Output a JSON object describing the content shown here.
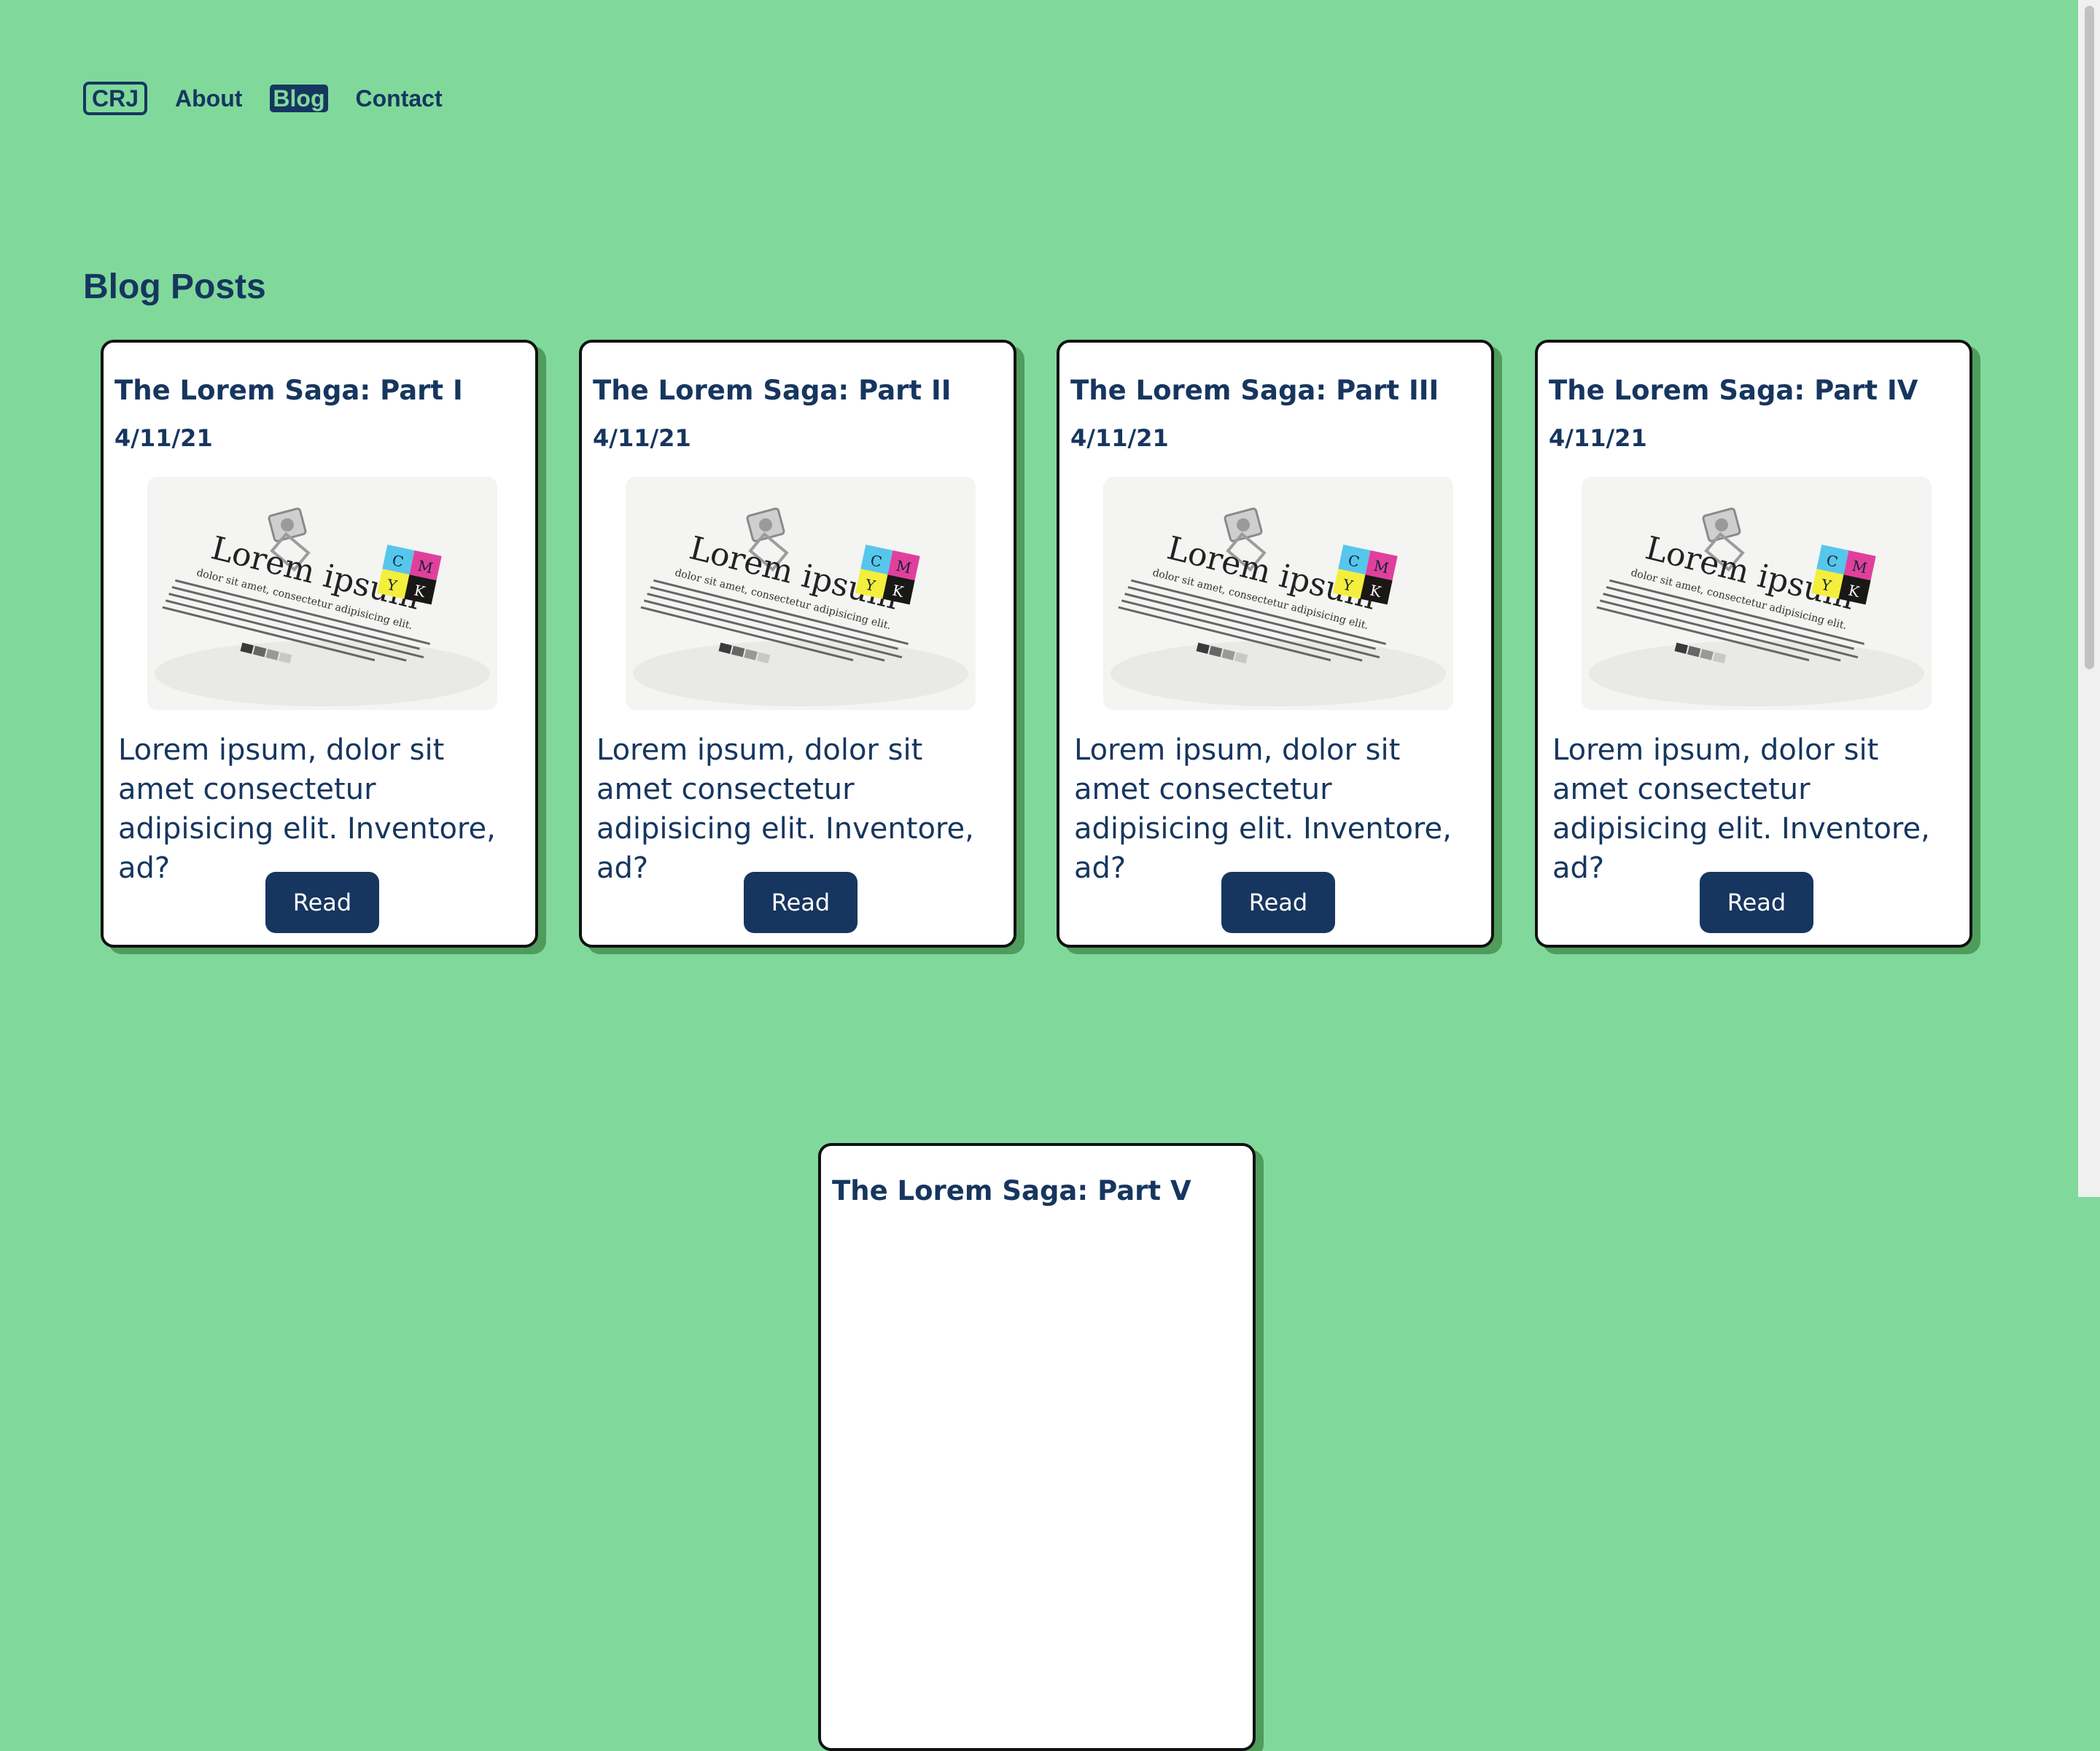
{
  "nav": {
    "logo": "CRJ",
    "items": [
      {
        "label": "About"
      },
      {
        "label": "Blog"
      },
      {
        "label": "Contact"
      }
    ]
  },
  "heading": "Blog Posts",
  "posts": [
    {
      "title": "The Lorem Saga: Part I",
      "date": "4/11/21",
      "excerpt": "Lorem ipsum, dolor sit amet consectetur adipisicing elit. Inventore, ad?",
      "button": "Read"
    },
    {
      "title": "The Lorem Saga: Part II",
      "date": "4/11/21",
      "excerpt": "Lorem ipsum, dolor sit amet consectetur adipisicing elit. Inventore, ad?",
      "button": "Read"
    },
    {
      "title": "The Lorem Saga: Part III",
      "date": "4/11/21",
      "excerpt": "Lorem ipsum, dolor sit amet consectetur adipisicing elit. Inventore, ad?",
      "button": "Read"
    },
    {
      "title": "The Lorem Saga: Part IV",
      "date": "4/11/21",
      "excerpt": "Lorem ipsum, dolor sit amet consectetur adipisicing elit. Inventore, ad?",
      "button": "Read"
    },
    {
      "title": "The Lorem Saga: Part V"
    }
  ],
  "thumbnail": {
    "headline": "Lorem ipsum",
    "subline": "dolor sit amet, consectetur adipisicing elit.",
    "cmyk": [
      "C",
      "M",
      "Y",
      "K"
    ]
  },
  "colors": {
    "background": "#80d99b",
    "primary": "#16365f",
    "card": "#ffffff",
    "card_shadow": "#4f9c5d",
    "cyan": "#56c6ec",
    "magenta": "#e0409c",
    "yellow": "#f4ee3c",
    "black": "#1a1717"
  }
}
